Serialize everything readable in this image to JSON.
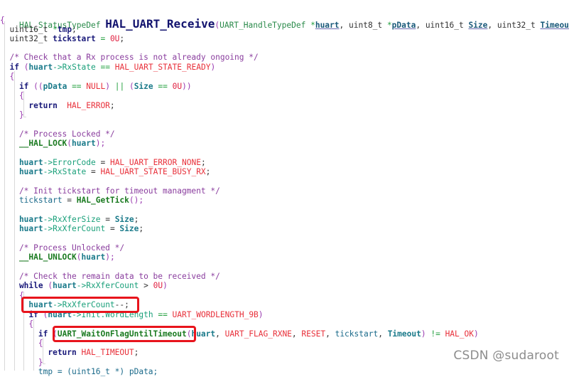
{
  "editor": {
    "signature": {
      "return_type": "HAL_StatusTypeDef",
      "function_name": "HAL_UART_Receive",
      "open_paren": "(",
      "p1_type": "UART_HandleTypeDef ",
      "p1_star": "*",
      "p1_name": "huart",
      "sep1": ", ",
      "p2_type": "uint8_t ",
      "p2_star": "*",
      "p2_name": "pData",
      "sep2": ", ",
      "p3_type": "uint16_t ",
      "p3_name": "Size",
      "sep3": ", ",
      "p4_type": "uint32_t ",
      "p4_name": "Timeout",
      "close_paren": ")"
    },
    "lines": {
      "l2": "{",
      "l3a": "  uint16_t ",
      "l3b": "*",
      "l3c": "tmp",
      "l3d": ";",
      "l4a": "  uint32_t ",
      "l4b": "tickstart",
      "l4c": " = ",
      "l4d": "0U",
      "l4e": ";",
      "l6": "  /* Check that a Rx process is not already ongoing */",
      "l7a": "  if ",
      "l7b": "(",
      "l7c": "huart",
      "l7d": "->",
      "l7e": "RxState",
      "l7f": " == ",
      "l7g": "HAL_UART_STATE_READY",
      "l7h": ")",
      "l8": "  {",
      "l9a": "    if ",
      "l9b": "((",
      "l9c": "pData",
      "l9d": " == ",
      "l9e": "NULL",
      "l9f": ") ",
      "l9g": "||",
      "l9h": " (",
      "l9i": "Size",
      "l9j": " == ",
      "l9k": "0U",
      "l9l": "))",
      "l10": "    {",
      "l11a": "      return  ",
      "l11b": "HAL_ERROR",
      "l11c": ";",
      "l12": "    }",
      "l14": "    /* Process Locked */",
      "l15a": "    __HAL_LOCK",
      "l15b": "(",
      "l15c": "huart",
      "l15d": ");",
      "l17a": "    huart",
      "l17b": "->",
      "l17c": "ErrorCode",
      "l17d": " = ",
      "l17e": "HAL_UART_ERROR_NONE",
      "l17f": ";",
      "l18a": "    huart",
      "l18b": "->",
      "l18c": "RxState",
      "l18d": " = ",
      "l18e": "HAL_UART_STATE_BUSY_RX",
      "l18f": ";",
      "l20": "    /* Init tickstart for timeout managment */",
      "l21a": "    tickstart",
      "l21b": " = ",
      "l21c": "HAL_GetTick",
      "l21d": "();",
      "l23a": "    huart",
      "l23b": "->",
      "l23c": "RxXferSize",
      "l23d": " = ",
      "l23e": "Size",
      "l23f": ";",
      "l24a": "    huart",
      "l24b": "->",
      "l24c": "RxXferCount",
      "l24d": " = ",
      "l24e": "Size",
      "l24f": ";",
      "l26": "    /* Process Unlocked */",
      "l27a": "    __HAL_UNLOCK",
      "l27b": "(",
      "l27c": "huart",
      "l27d": ");",
      "l29": "    /* Check the remain data to be received */",
      "l30a": "    while ",
      "l30b": "(",
      "l30c": "huart",
      "l30d": "->",
      "l30e": "RxXferCount",
      "l30f": " > ",
      "l30g": "0U",
      "l30h": ")",
      "l31": "    {",
      "l32a": "      huart",
      "l32b": "->",
      "l32c": "RxXferCount",
      "l32d": "--",
      "l32e": ";",
      "l33a": "      if ",
      "l33b": "(",
      "l33c": "huart",
      "l33d": "->",
      "l33e": "Init.WordLength",
      "l33f": " == ",
      "l33g": "UART_WORDLENGTH_9B",
      "l33h": ")",
      "l34": "      {",
      "l35a": "        if ",
      "l35b": "(",
      "l35c": "UART_WaitOnFlagUntilTimeout",
      "l35d": "(",
      "l35e": "huart",
      "l35f": ", ",
      "l35g": "UART_FLAG_RXNE",
      "l35h": ", ",
      "l35i": "RESET",
      "l35j": ", ",
      "l35k": "tickstart",
      "l35l": ", ",
      "l35m": "Timeout",
      "l35n": ") ",
      "l35o": "!=",
      "l35p": " ",
      "l35q": "HAL_OK",
      "l35r": ")",
      "l36": "        {",
      "l37a": "          return ",
      "l37b": "HAL_TIMEOUT",
      "l37c": ";",
      "l38": "        }",
      "l39": "        tmp = (uint16_t *) pData;"
    }
  },
  "highlights": [
    {
      "label": "huart->RxXferCount--;"
    },
    {
      "label": "(UART_WaitOnFlagUntilTimeout("
    }
  ],
  "watermark": "CSDN @sudaroot",
  "colors": {
    "highlight_box": "#e8141c",
    "function_name": "#11126e",
    "macro": "#e8303a",
    "comment": "#8a3d9e",
    "type": "#2a8a4a"
  }
}
